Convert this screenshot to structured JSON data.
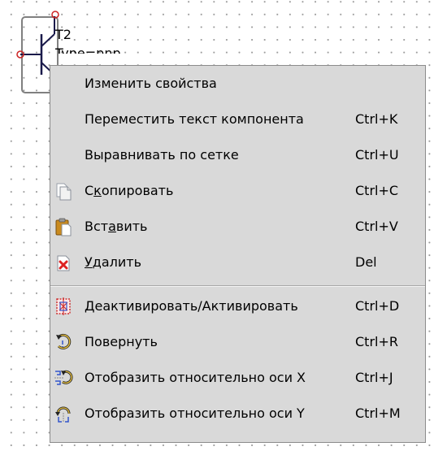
{
  "component": {
    "reference": "T2",
    "value": "Type=pnp"
  },
  "context_menu": {
    "items": [
      {
        "label": "Изменить свойства",
        "shortcut": "",
        "icon": ""
      },
      {
        "label": "Переместить текст компонента",
        "shortcut": "Ctrl+K",
        "icon": ""
      },
      {
        "label": "Выравнивать по сетке",
        "shortcut": "Ctrl+U",
        "icon": ""
      },
      {
        "label_pre": "С",
        "label_u": "к",
        "label_post": "опировать",
        "shortcut": "Ctrl+C",
        "icon": "copy-icon"
      },
      {
        "label_pre": "Вст",
        "label_u": "а",
        "label_post": "вить",
        "shortcut": "Ctrl+V",
        "icon": "paste-icon"
      },
      {
        "label_pre": "",
        "label_u": "У",
        "label_post": "далить",
        "shortcut": "Del",
        "icon": "delete-icon"
      },
      {
        "label": "Деактивировать/Активировать",
        "shortcut": "Ctrl+D",
        "icon": "toggle-active-icon"
      },
      {
        "label": "Повернуть",
        "shortcut": "Ctrl+R",
        "icon": "rotate-icon"
      },
      {
        "label": "Отобразить относительно оси X",
        "shortcut": "Ctrl+J",
        "icon": "mirror-x-icon"
      },
      {
        "label": "Отобразить относительно оси Y",
        "shortcut": "Ctrl+M",
        "icon": "mirror-y-icon"
      }
    ]
  }
}
